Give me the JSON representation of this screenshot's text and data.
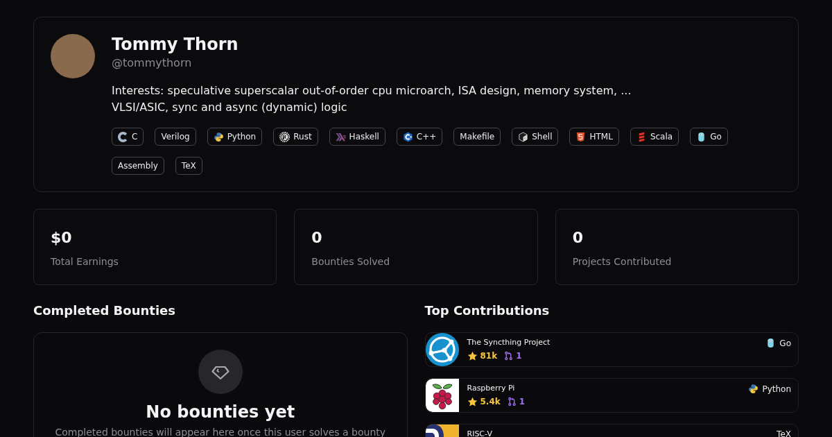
{
  "profile": {
    "name": "Tommy Thorn",
    "handle": "@tommythorn",
    "bio_lines": [
      "Interests: speculative superscalar out-of-order cpu microarch, ISA design, memory system, ...",
      "VLSI/ASIC, sync and async (dynamic) logic"
    ],
    "languages": [
      {
        "name": "C",
        "kind": "c"
      },
      {
        "name": "Verilog",
        "kind": "plain"
      },
      {
        "name": "Python",
        "kind": "python"
      },
      {
        "name": "Rust",
        "kind": "rust"
      },
      {
        "name": "Haskell",
        "kind": "haskell"
      },
      {
        "name": "C++",
        "kind": "cpp"
      },
      {
        "name": "Makefile",
        "kind": "plain"
      },
      {
        "name": "Shell",
        "kind": "shell"
      },
      {
        "name": "HTML",
        "kind": "html"
      },
      {
        "name": "Scala",
        "kind": "scala"
      },
      {
        "name": "Go",
        "kind": "go"
      },
      {
        "name": "Assembly",
        "kind": "plain"
      },
      {
        "name": "TeX",
        "kind": "plain"
      }
    ]
  },
  "stats": [
    {
      "value": "$0",
      "label": "Total Earnings"
    },
    {
      "value": "0",
      "label": "Bounties Solved"
    },
    {
      "value": "0",
      "label": "Projects Contributed"
    }
  ],
  "completed_bounties": {
    "title": "Completed Bounties",
    "empty_title": "No bounties yet",
    "empty_text": "Completed bounties will appear here once this user solves a bounty"
  },
  "top_contributions": {
    "title": "Top Contributions",
    "items": [
      {
        "name": "The Syncthing Project",
        "kind": "globe",
        "stars": "81k",
        "pull_requests": "1",
        "language": {
          "name": "Go",
          "kind": "go"
        }
      },
      {
        "name": "Raspberry Pi",
        "kind": "berry",
        "stars": "5.4k",
        "pull_requests": "1",
        "language": {
          "name": "Python",
          "kind": "python"
        }
      },
      {
        "name": "RISC-V",
        "kind": "split",
        "language": {
          "name": "TeX",
          "kind": "plain"
        }
      }
    ]
  }
}
